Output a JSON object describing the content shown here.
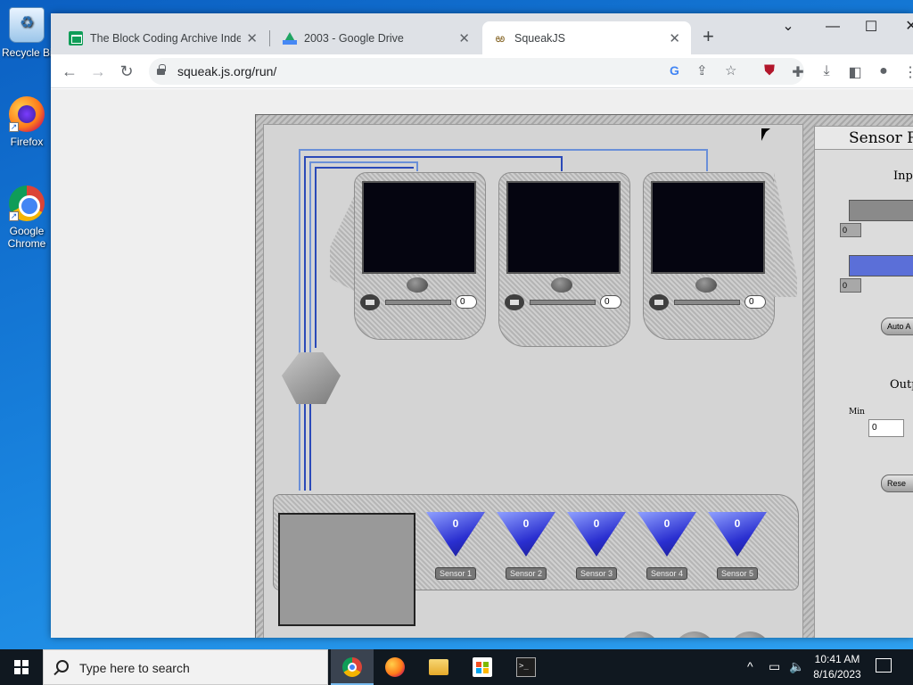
{
  "desktop": {
    "icons": [
      {
        "label": "Recycle Bin",
        "shortcut": false
      },
      {
        "label": "Firefox",
        "shortcut": true
      },
      {
        "label": "Google Chrome",
        "shortcut": true
      }
    ]
  },
  "browser": {
    "tabs": [
      {
        "title": "The Block Coding Archive Index",
        "active": false,
        "favicon": "sheets-icon"
      },
      {
        "title": "2003 - Google Drive",
        "active": false,
        "favicon": "drive-icon"
      },
      {
        "title": "SqueakJS",
        "active": true,
        "favicon": "squeak-icon"
      }
    ],
    "url": "squeak.js.org/run/"
  },
  "squeak": {
    "monitors": [
      {
        "value": "0"
      },
      {
        "value": "0"
      },
      {
        "value": "0"
      }
    ],
    "sensors": [
      {
        "value": "0",
        "label": "Sensor 1"
      },
      {
        "value": "0",
        "label": "Sensor 2"
      },
      {
        "value": "0",
        "label": "Sensor 3"
      },
      {
        "value": "0",
        "label": "Sensor 4"
      },
      {
        "value": "0",
        "label": "Sensor 5"
      }
    ],
    "right_panel": {
      "title": "Sensor Ra",
      "input_label": "Inpu",
      "bar1_value": "0",
      "bar2_value": "0",
      "auto_button": "Auto A",
      "output_label": "Outp",
      "min_label": "Min",
      "min_value": "0",
      "reset_button": "Rese",
      "bar1_color": "#8a8a8a",
      "bar2_color": "#5b6fd8"
    }
  },
  "taskbar": {
    "search_placeholder": "Type here to search",
    "time": "10:41 AM",
    "date": "8/16/2023"
  }
}
